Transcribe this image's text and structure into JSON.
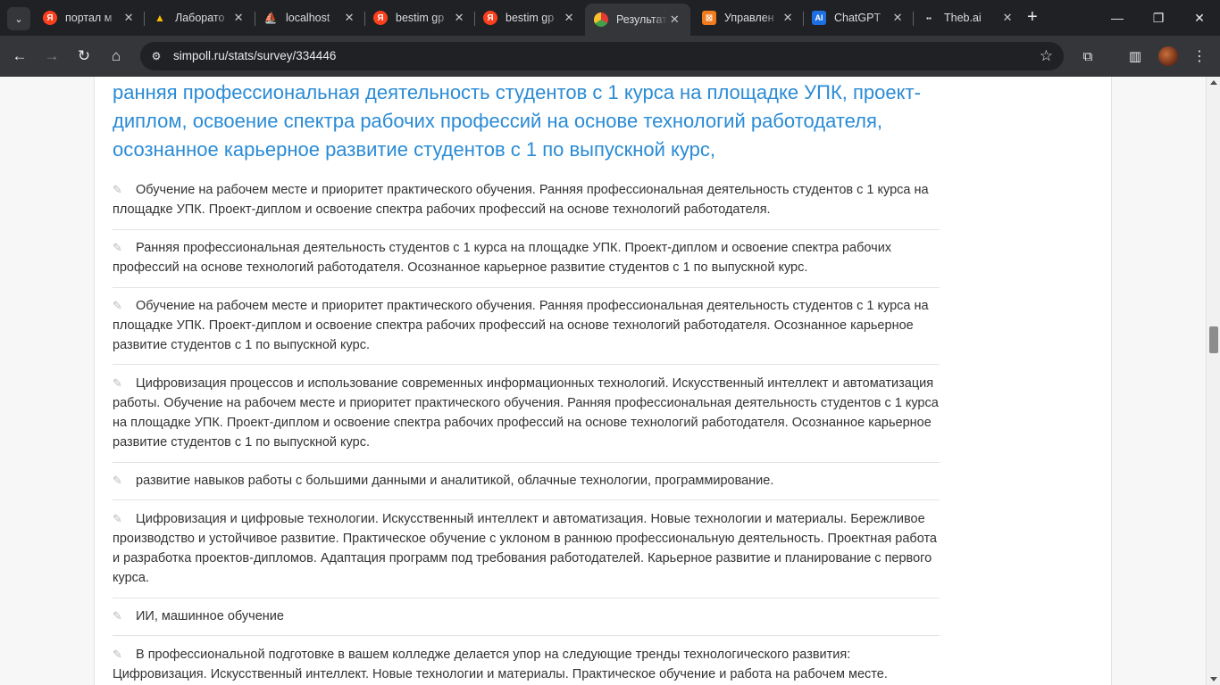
{
  "browser": {
    "tabs": [
      {
        "title": "портал м",
        "icon": "yandex-icon",
        "color": "#fc3f1d",
        "glyph": "Я"
      },
      {
        "title": "Лаборато",
        "icon": "google-drive-icon",
        "color": "#1fa463",
        "glyph": "▲"
      },
      {
        "title": "localhost",
        "icon": "pma-icon",
        "color": "#f29111",
        "glyph": "⛵"
      },
      {
        "title": "bestim gp",
        "icon": "yandex-icon",
        "color": "#fc3f1d",
        "glyph": "Я"
      },
      {
        "title": "bestim gp",
        "icon": "yandex-icon",
        "color": "#fc3f1d",
        "glyph": "Я"
      },
      {
        "title": "Результат",
        "icon": "simpoll-icon",
        "color": "#e5a21c",
        "glyph": "●",
        "active": true
      },
      {
        "title": "Управлен",
        "icon": "orange-box-icon",
        "color": "#f07c1e",
        "glyph": "⊠"
      },
      {
        "title": "ChatGPT",
        "icon": "ai-icon",
        "color": "#1e6fe0",
        "glyph": "AI"
      },
      {
        "title": "Theb.ai",
        "icon": "theb-icon",
        "color": "#3c4043",
        "glyph": "▪▪"
      }
    ],
    "url": "simpoll.ru/stats/survey/334446"
  },
  "content": {
    "heading": "ранняя профессиональная деятельность студентов с 1 курса на площадке УПК, проект-диплом, освоение спектра рабочих профессий на основе технологий работодателя, осознанное карьерное развитие студентов с 1 по выпускной курс,",
    "answers": [
      "Обучение на рабочем месте и приоритет практического обучения. Ранняя профессиональная деятельность студентов с 1 курса на площадке УПК. Проект-диплом и освоение спектра рабочих профессий на основе технологий работодателя.",
      "Ранняя профессиональная деятельность студентов с 1 курса на площадке УПК. Проект-диплом и освоение спектра рабочих профессий на основе технологий работодателя. Осознанное карьерное развитие студентов с 1 по выпускной курс.",
      "Обучение на рабочем месте и приоритет практического обучения. Ранняя профессиональная деятельность студентов с 1 курса на площадке УПК. Проект-диплом и освоение спектра рабочих профессий на основе технологий работодателя. Осознанное карьерное развитие студентов с 1 по выпускной курс.",
      "Цифровизация процессов и использование современных информационных технологий. Искусственный интеллект и автоматизация работы. Обучение на рабочем месте и приоритет практического обучения. Ранняя профессиональная деятельность студентов с 1 курса на площадке УПК. Проект-диплом и освоение спектра рабочих профессий на основе технологий работодателя. Осознанное карьерное развитие студентов с 1 по выпускной курс.",
      "развитие навыков работы с большими данными и аналитикой, облачные технологии, программирование.",
      "Цифровизация и цифровые технологии. Искусственный интеллект и автоматизация. Новые технологии и материалы. Бережливое производство и устойчивое развитие. Практическое обучение с уклоном в раннюю профессиональную деятельность. Проектная работа и разработка проектов-дипломов. Адаптация программ под требования работодателей. Карьерное развитие и планирование с первого курса.",
      "ИИ, машинное обучение",
      "В профессиональной подготовке в вашем колледже делается упор на следующие тренды технологического развития: Цифровизация. Искусственный интеллект. Новые технологии и материалы. Практическое обучение и работа на рабочем месте."
    ]
  }
}
